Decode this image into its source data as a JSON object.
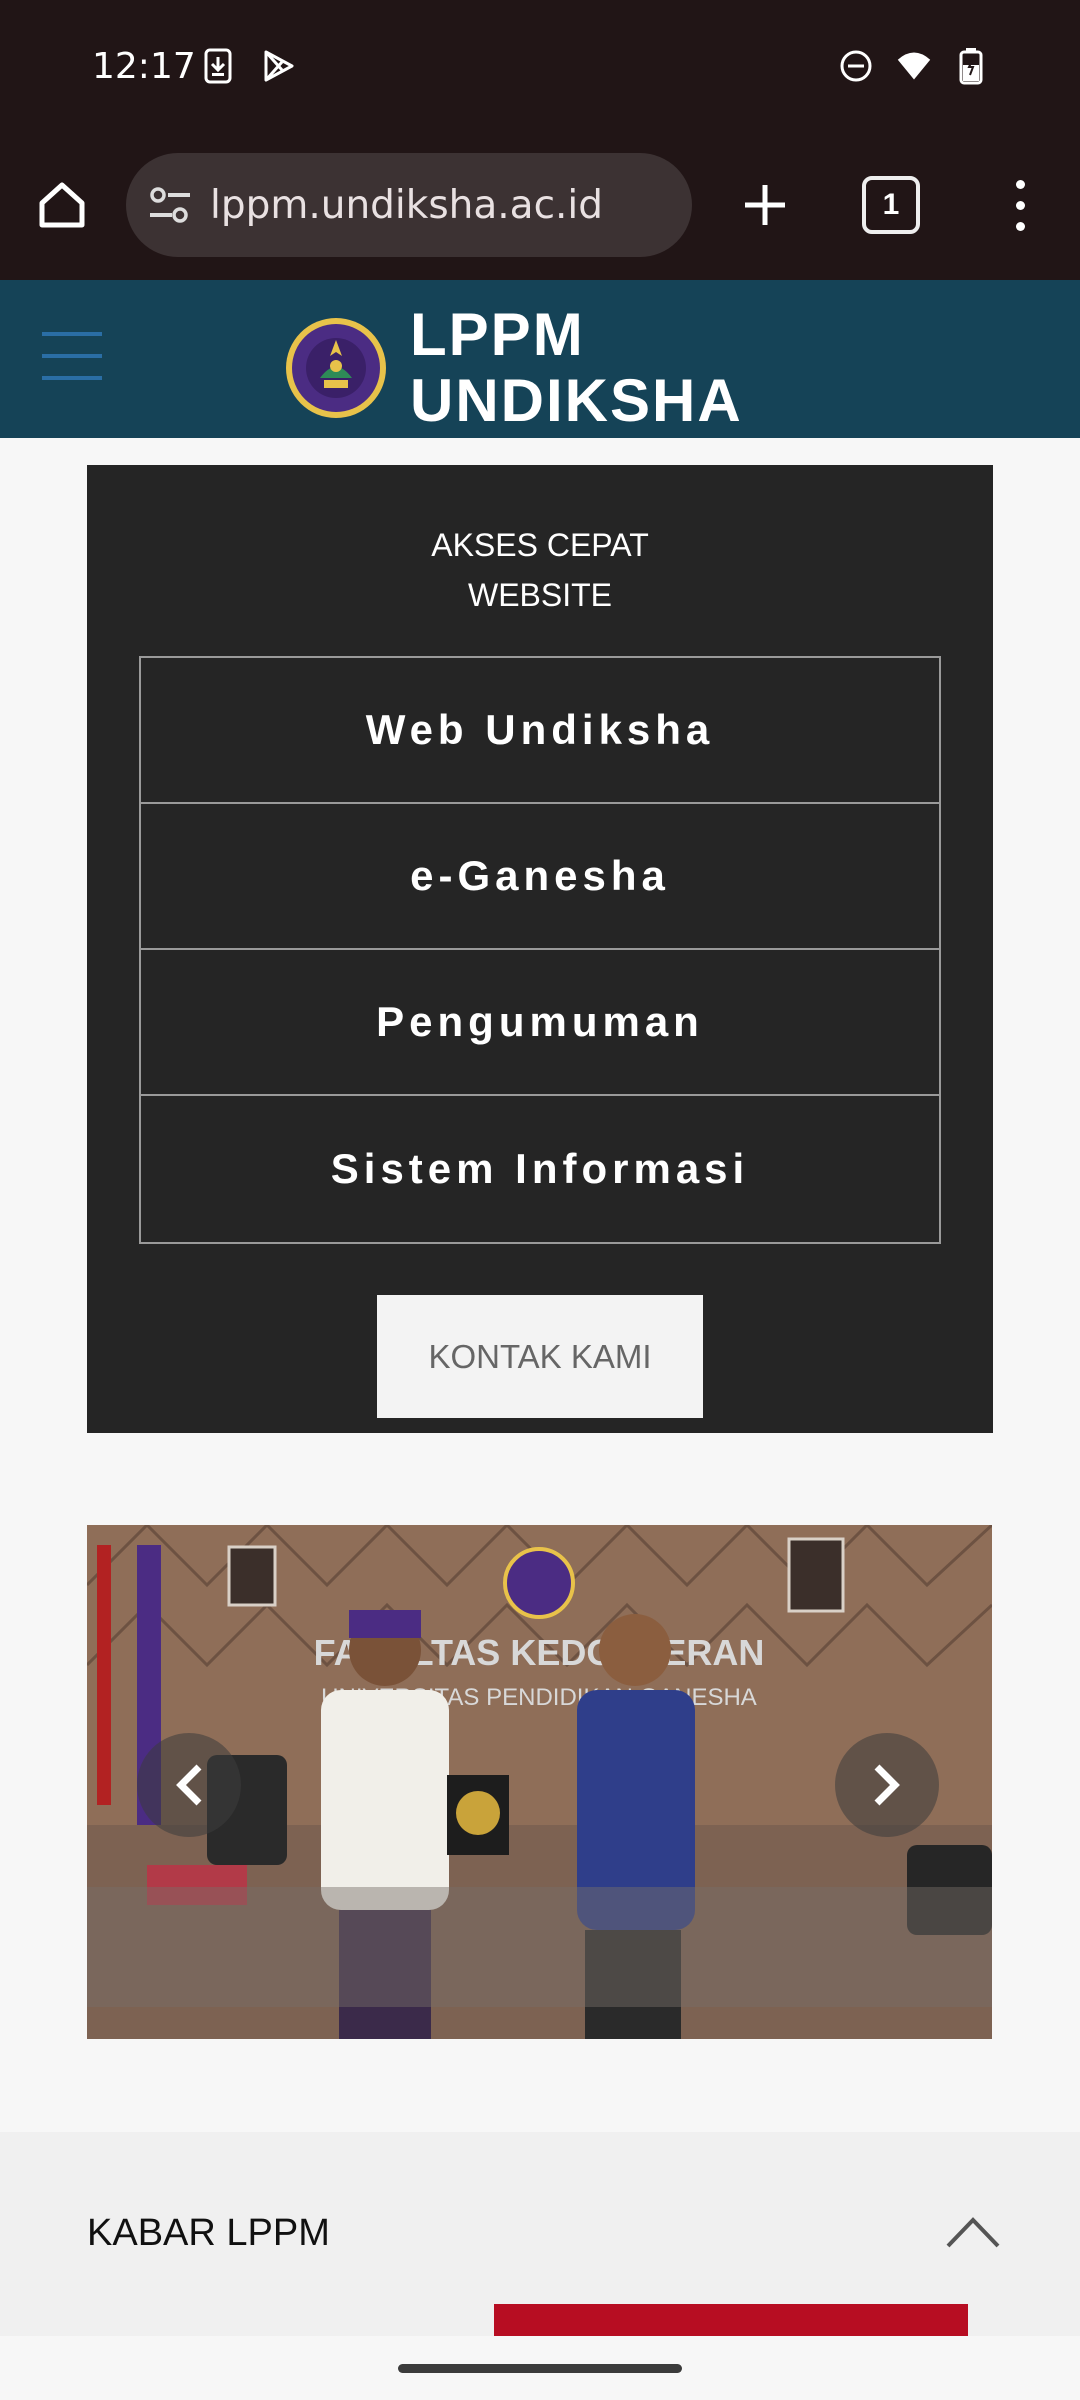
{
  "status_bar": {
    "time": "12:17",
    "left_icons": [
      "download-icon",
      "play-store-icon"
    ],
    "right_icons": [
      "dnd-icon",
      "wifi-icon",
      "battery-icon"
    ]
  },
  "browser": {
    "url": "lppm.undiksha.ac.id",
    "tab_count": "1"
  },
  "site_header": {
    "logo_line1": "LPPM",
    "logo_line2": "UNDIKSHA",
    "colors": {
      "header_bg": "#154357",
      "menu_accent": "#2a6ea5"
    }
  },
  "quick_access": {
    "title_line1": "AKSES CEPAT",
    "title_line2": "WEBSITE",
    "links": [
      {
        "label": "Web Undiksha"
      },
      {
        "label": "e-Ganesha"
      },
      {
        "label": "Pengumuman"
      },
      {
        "label": "Sistem Informasi"
      }
    ],
    "contact_label": "KONTAK KAMI"
  },
  "carousel": {
    "sign_line1": "FAKULTAS KEDOKTERAN",
    "sign_line2": "UNIVERSITAS PENDIDIKAN GANESHA"
  },
  "kabar": {
    "title": "KABAR LPPM",
    "accent": "#b70d22"
  }
}
